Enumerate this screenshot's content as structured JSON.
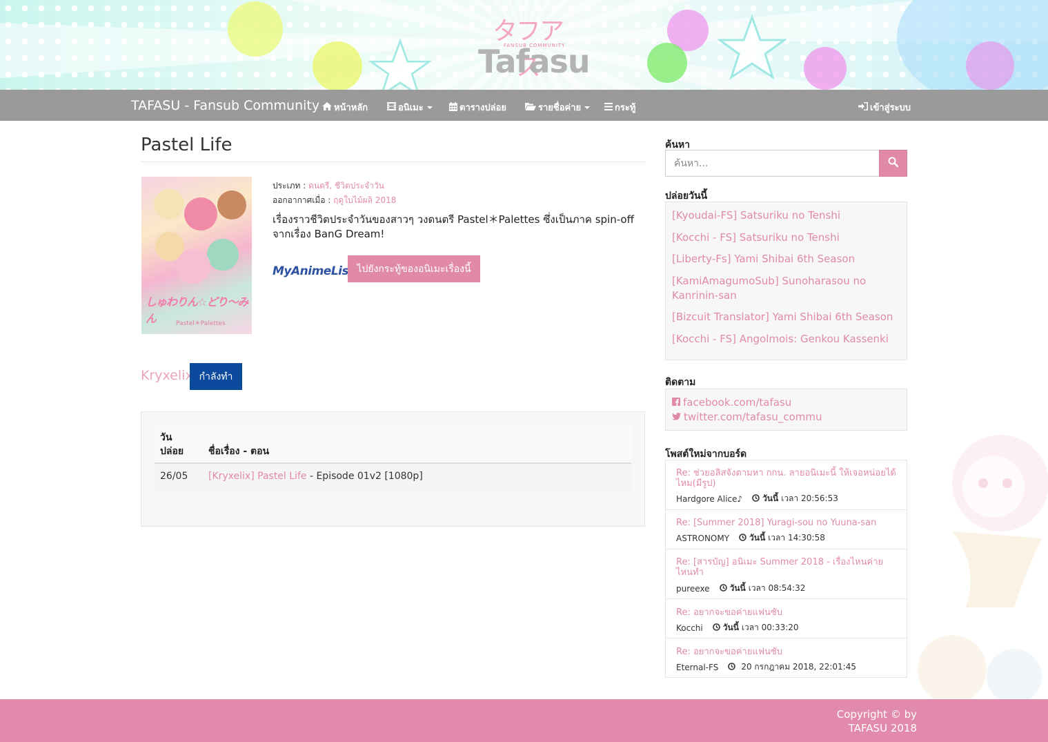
{
  "banner": {
    "logo_kana": "タフアス",
    "logo_sub": "FANSUB COMMUNITY",
    "logo_main": "Tafasu"
  },
  "navbar": {
    "brand": "TAFASU - Fansub Community",
    "items": [
      {
        "icon": "home-icon",
        "label": "หน้าหลัก",
        "dropdown": false
      },
      {
        "icon": "film-icon",
        "label": "อนิเมะ",
        "dropdown": true
      },
      {
        "icon": "calendar-icon",
        "label": "ตารางปล่อย",
        "dropdown": false
      },
      {
        "icon": "folder-open-icon",
        "label": "รายชื่อค่าย",
        "dropdown": true
      },
      {
        "icon": "list-icon",
        "label": "กระทู้",
        "dropdown": false
      }
    ],
    "login": {
      "icon": "sign-in-icon",
      "label": "เข้าสู่ระบบ"
    }
  },
  "anime": {
    "title": "Pastel Life",
    "genre_label": "ประเภท :",
    "genre_value": "ดนตรี, ชีวิตประจำวัน",
    "aired_label": "ออกอากาศเมื่อ :",
    "aired_value": "ฤดูใบไม้ผลิ 2018",
    "synopsis": "เรื่องราวชีวิตประจำวันของสาวๆ วงดนตรี Pastel＊Palettes ซึ่งเป็นภาค spin-off จากเรื่อง BanG Dream!",
    "mal_label": "MyAnimeList",
    "thread_button": "ไปยังกระทู้ของอนิเมะเรื่องนี้",
    "poster_text": "しゅわりん☆どり〜みん",
    "poster_sub": "Pastel＊Palettes"
  },
  "group": {
    "name": "Kryxelix",
    "status": "กำลังทำ"
  },
  "releases": {
    "headers": [
      "วัน ปล่อย",
      "ชื่อเรื่อง - ตอน"
    ],
    "rows": [
      {
        "date": "26/05",
        "link": "[Kryxelix] Pastel Life",
        "episode": "- Episode 01v2 [1080p]"
      }
    ]
  },
  "sidebar": {
    "search_heading": "ค้นหา",
    "search_placeholder": "ค้นหา...",
    "today_heading": "ปล่อยวันนี้",
    "today_items": [
      "[Kyoudai-FS] Satsuriku no Tenshi",
      "[Kocchi - FS] Satsuriku no Tenshi",
      "[Liberty-Fs] Yami Shibai 6th Season",
      "[KamiAmagumoSub] Sunoharasou no Kanrinin-san",
      "[Bizcuit Translator] Yami Shibai 6th Season",
      "[Kocchi - FS] Angolmois: Genkou Kassenki"
    ],
    "follow_heading": "ติดตาม",
    "follow_links": [
      {
        "icon": "facebook-icon",
        "label": "facebook.com/tafasu"
      },
      {
        "icon": "twitter-icon",
        "label": "twitter.com/tafasu_commu"
      }
    ],
    "posts_heading": "โพสต์ใหม่จากบอร์ด",
    "posts": [
      {
        "title": "Re: ช่วยอลิสจังตามหา กกน. ลายอนิเมะนี้ ให้เจอหน่อยได้ไหม(มีรูป)",
        "author": "Hardgore Alice♪",
        "when_bold": "วันนี้",
        "when": "เวลา 20:56:53"
      },
      {
        "title": "Re: [Summer 2018] Yuragi-sou no Yuuna-san",
        "author": "ASTRONOMY",
        "when_bold": "วันนี้",
        "when": "เวลา 14:30:58"
      },
      {
        "title": "Re: [สารบัญ] อนิเมะ Summer 2018 - เรื่องไหนค่ายไหนทำ",
        "author": "pureexe",
        "when_bold": "วันนี้",
        "when": "เวลา 08:54:32"
      },
      {
        "title": "Re: อยากจะขอค่ายแฟนซับ",
        "author": "Kocchi",
        "when_bold": "วันนี้",
        "when": "เวลา 00:33:20"
      },
      {
        "title": "Re: อยากจะขอค่ายแฟนซับ",
        "author": "Eternal-FS",
        "when_bold": "",
        "when": "20 กรกฎาคม 2018, 22:01:45"
      }
    ]
  },
  "footer": {
    "line1": "Copyright © by",
    "line2": "TAFASU 2018"
  },
  "colors": {
    "accent": "#e08aa8",
    "navbar": "#9a9a9a",
    "status_button": "#0b4a9c",
    "footer": "#e28aab",
    "mal_blue": "#2e51a2"
  }
}
